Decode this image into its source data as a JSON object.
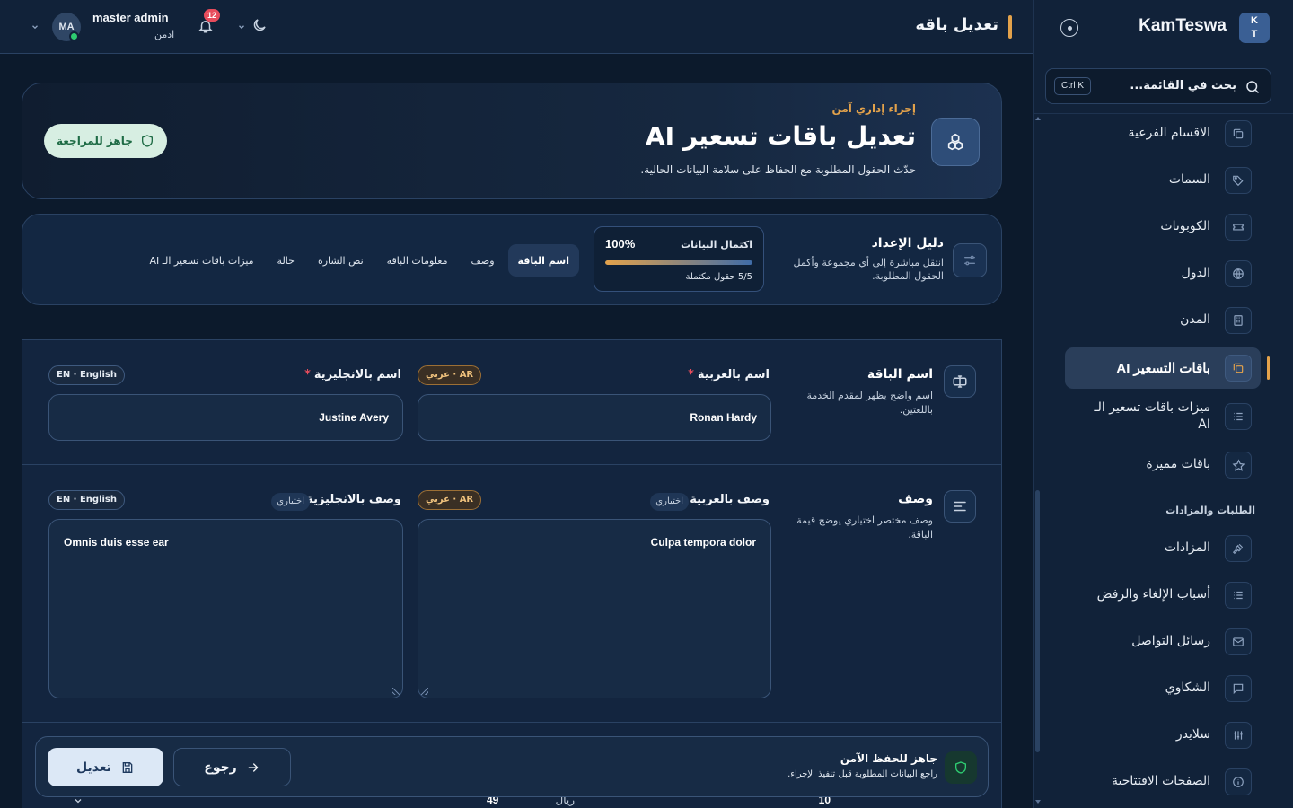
{
  "sidebar": {
    "brand": {
      "logo_top": "K",
      "logo_bottom": "T",
      "name": "KamTeswa"
    },
    "search": {
      "placeholder": "بحث في القائمة...",
      "shortcut": "Ctrl K"
    },
    "items": [
      {
        "label": "الاقسام الفرعية",
        "icon": "copy-icon"
      },
      {
        "label": "السمات",
        "icon": "tag-icon"
      },
      {
        "label": "الكوبونات",
        "icon": "ticket-icon"
      },
      {
        "label": "الدول",
        "icon": "globe-icon"
      },
      {
        "label": "المدن",
        "icon": "building-icon"
      },
      {
        "label": "باقات التسعير AI",
        "icon": "copy-icon",
        "active": true
      },
      {
        "label": "ميزات باقات تسعير الـ AI",
        "icon": "list-icon"
      },
      {
        "label": "باقات مميزة",
        "icon": "star-icon"
      }
    ],
    "section_title": "الطلبات والمزادات",
    "section_items": [
      {
        "label": "المزادات",
        "icon": "gavel-icon"
      },
      {
        "label": "أسباب الإلغاء والرفض",
        "icon": "list-icon"
      },
      {
        "label": "رسائل التواصل",
        "icon": "mail-icon"
      },
      {
        "label": "الشكاوي",
        "icon": "message-icon"
      },
      {
        "label": "سلايدر",
        "icon": "sliders-icon"
      },
      {
        "label": "الصفحات الافتتاحية",
        "icon": "info-icon"
      }
    ]
  },
  "topbar": {
    "page_title": "تعديل باقه",
    "user": {
      "initials": "MA",
      "name": "master admin",
      "role": "ادمن"
    },
    "notifications_count": "12"
  },
  "hero": {
    "eyebrow": "إجراء إداري آمن",
    "title": "تعديل باقات تسعير AI",
    "subtitle": "حدّث الحقول المطلوبة مع الحفاظ على سلامة البيانات الحالية.",
    "status": "جاهز للمراجعة"
  },
  "guide": {
    "title": "دليل الإعداد",
    "description": "انتقل مباشرة إلى أي مجموعة وأكمل الحقول المطلوبة.",
    "progress_label": "اكتمال البيانات",
    "progress_percent": "100%",
    "progress_value": 1.0,
    "progress_count": "5/5 حقول مكتملة",
    "tabs": [
      {
        "label": "اسم الباقة",
        "active": true
      },
      {
        "label": "وصف"
      },
      {
        "label": "معلومات الباقه"
      },
      {
        "label": "نص الشارة"
      },
      {
        "label": "حالة"
      },
      {
        "label": "ميزات باقات تسعير الـ AI"
      }
    ]
  },
  "sections": {
    "name": {
      "title": "اسم الباقة",
      "description": "اسم واضح يظهر لمقدم الخدمة باللغتين.",
      "ar_label": "اسم بالعربية",
      "en_label": "اسم بالانجليزية",
      "ar_value": "Ronan Hardy",
      "en_value": "Justine Avery"
    },
    "description": {
      "title": "وصف",
      "description": "وصف مختصر اختياري يوضح قيمة الباقة.",
      "ar_label": "وصف بالعربية",
      "en_label": "وصف بالانجليزية",
      "optional": "اختياري",
      "ar_value": "Culpa tempora dolor",
      "en_value": "Omnis duis esse ear"
    },
    "lang_ar": "AR · عربي",
    "lang_en": "EN · English",
    "required_mark": "*"
  },
  "peek": {
    "currency": "ريال",
    "value_a": "10",
    "value_b": "49"
  },
  "action_bar": {
    "title": "جاهز للحفظ الآمن",
    "subtitle": "راجع البيانات المطلوبة قبل تنفيذ الإجراء.",
    "back_label": "رجوع",
    "save_label": "تعديل"
  },
  "colors": {
    "accent": "#e3a24b",
    "background": "#0c1a2c",
    "panel": "#13253f",
    "success": "#2ecc71",
    "danger": "#e74c5c"
  }
}
